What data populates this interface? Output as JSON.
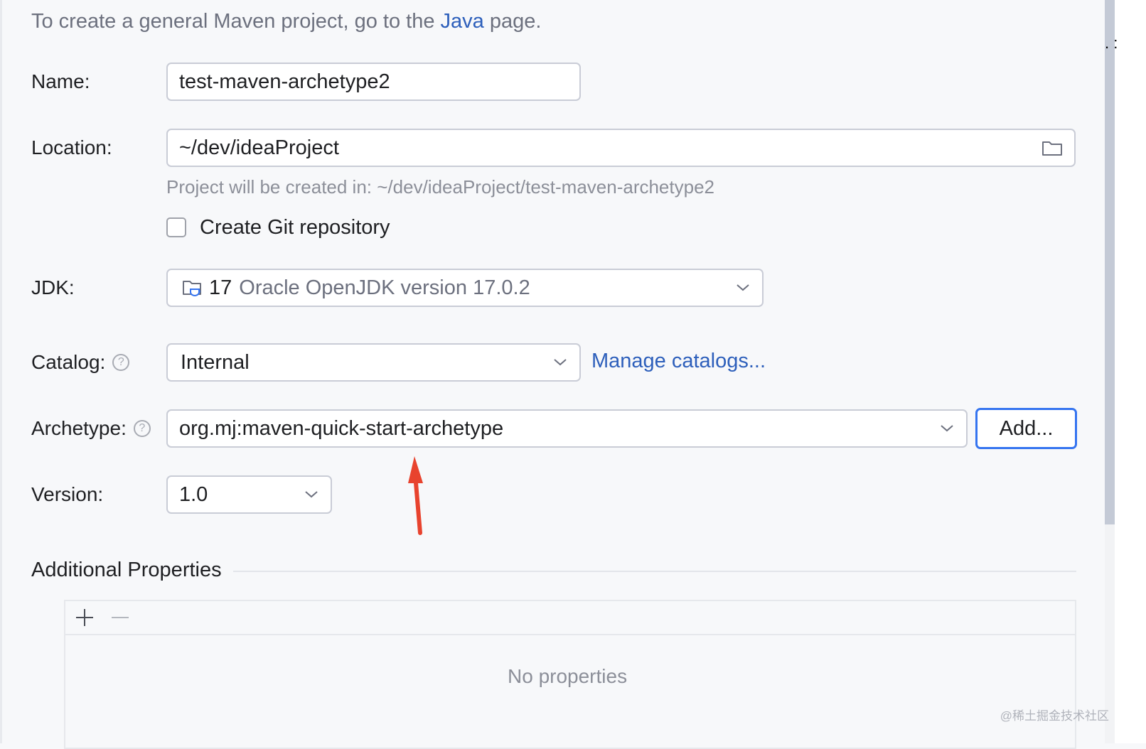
{
  "intro": {
    "prefix": "To create a general Maven project, go to the",
    "link": "Java",
    "suffix": "page."
  },
  "name": {
    "label": "Name:",
    "value": "test-maven-archetype2"
  },
  "location": {
    "label": "Location:",
    "value": "~/dev/ideaProject",
    "hint": "Project will be created in: ~/dev/ideaProject/test-maven-archetype2"
  },
  "git": {
    "label": "Create Git repository",
    "checked": false
  },
  "jdk": {
    "label": "JDK:",
    "version": "17",
    "description": "Oracle OpenJDK version 17.0.2",
    "icon": "jdk-folder-icon"
  },
  "catalog": {
    "label": "Catalog:",
    "value": "Internal",
    "manage_link": "Manage catalogs..."
  },
  "archetype": {
    "label": "Archetype:",
    "value": "org.mj:maven-quick-start-archetype",
    "add_button": "Add..."
  },
  "version": {
    "label": "Version:",
    "value": "1.0"
  },
  "additional": {
    "title": "Additional Properties",
    "add_icon": "+",
    "remove_icon": "—",
    "empty_text": "No properties"
  },
  "watermark": "@稀土掘金技术社区",
  "colors": {
    "link": "#2d5fbb",
    "focus": "#3574f0",
    "annotation_arrow": "#e8432e"
  }
}
